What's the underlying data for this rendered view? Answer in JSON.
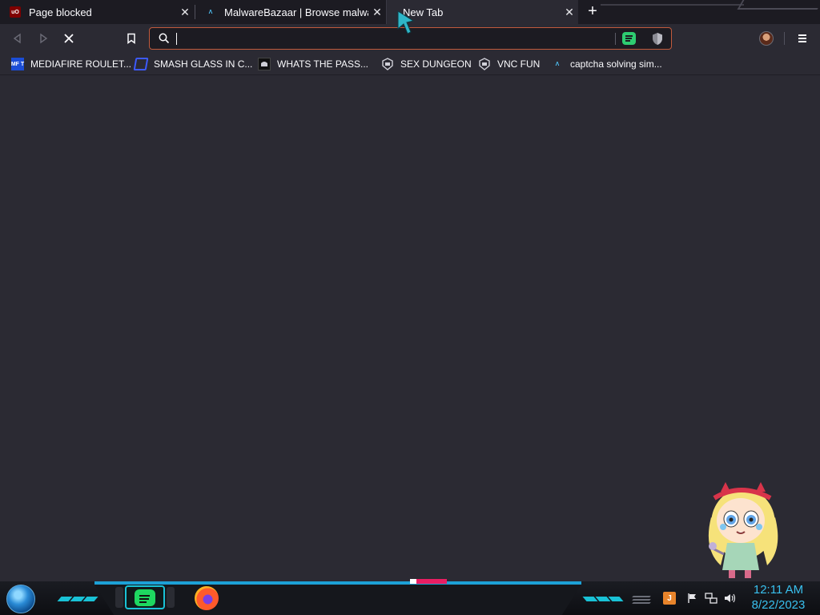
{
  "tabs": [
    {
      "title": "Page blocked",
      "favicon": "ublock-icon",
      "active": false
    },
    {
      "title": "MalwareBazaar | Browse malware samples",
      "favicon": "malwarebazaar-icon",
      "active": false
    },
    {
      "title": "New Tab",
      "favicon": "",
      "active": true
    }
  ],
  "tab_close_glyph": "✕",
  "new_tab_glyph": "+",
  "toolbar": {
    "back_icon": "back-arrow-icon",
    "forward_icon": "forward-arrow-icon",
    "stop_icon": "stop-icon",
    "bookmark_icon": "bookmark-icon",
    "url_value": "",
    "url_placeholder": ""
  },
  "favicons": {
    "ublock": "uO",
    "mediafire": "MF T",
    "malwarebazaar": "Λ"
  },
  "bookmarks": [
    {
      "label": "MEDIAFIRE ROULET...",
      "icon": "mediafire-icon"
    },
    {
      "label": "SMASH GLASS IN C...",
      "icon": "smash-glass-icon"
    },
    {
      "label": "WHATS THE PASS...",
      "icon": "password-site-icon"
    },
    {
      "label": "SEX DUNGEON",
      "icon": "dungeon-icon"
    },
    {
      "label": "VNC FUN",
      "icon": "vnc-icon"
    },
    {
      "label": "captcha solving sim...",
      "icon": "captcha-site-icon"
    }
  ],
  "taskbar": {
    "apps": [
      "spotify-icon",
      "firefox-icon"
    ],
    "tray": [
      "java-icon",
      "action-center-flag-icon",
      "network-icon",
      "volume-icon"
    ],
    "time": "12:11 AM",
    "date": "8/22/2023"
  },
  "colors": {
    "page_bg": "#2b2a33",
    "tabstrip_bg": "#1c1b22",
    "urlbar_border": "#c15a3c",
    "clock": "#39c0ee",
    "taskbar_accent": "#19c2d6"
  }
}
